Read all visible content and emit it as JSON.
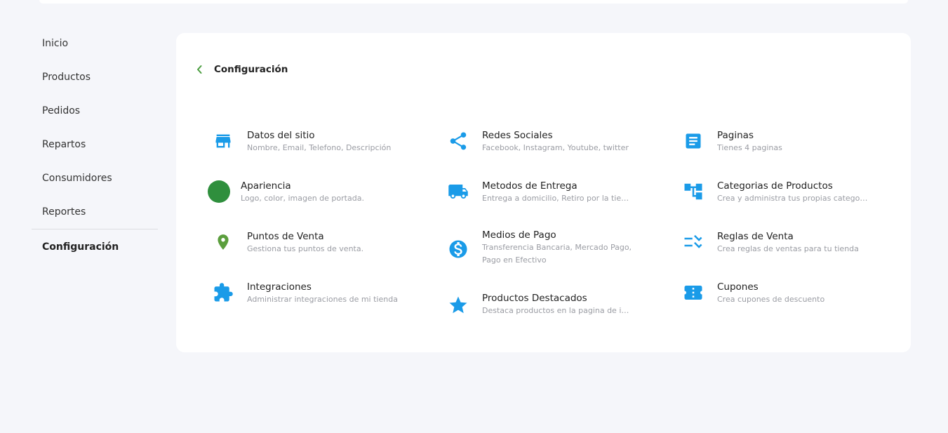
{
  "sidebar": {
    "items": [
      {
        "label": "Inicio"
      },
      {
        "label": "Productos"
      },
      {
        "label": "Pedidos"
      },
      {
        "label": "Repartos"
      },
      {
        "label": "Consumidores"
      },
      {
        "label": "Reportes"
      },
      {
        "label": "Configuración"
      }
    ]
  },
  "header": {
    "title": "Configuración"
  },
  "colors": {
    "accent_blue": "#1a9be8",
    "green": "#2f8f3d",
    "pin_green": "#5b9e3d",
    "back_arrow": "#4a9d3e"
  },
  "items": {
    "datos": {
      "title": "Datos del sitio",
      "subtitle": "Nombre, Email, Telefono, Descripción",
      "icon": "store-icon"
    },
    "redes": {
      "title": "Redes Sociales",
      "subtitle": "Facebook, Instagram, Youtube, twitter",
      "icon": "share-icon"
    },
    "paginas": {
      "title": "Paginas",
      "subtitle": "Tienes 4 paginas",
      "icon": "document-icon"
    },
    "apariencia": {
      "title": "Apariencia",
      "subtitle": "Logo, color, imagen de portada.",
      "icon": "color-circle-icon"
    },
    "entrega": {
      "title": "Metodos de Entrega",
      "subtitle": "Entrega a domicilio, Retiro por la tienda",
      "icon": "truck-icon"
    },
    "categorias": {
      "title": "Categorias de Productos",
      "subtitle": "Crea y administra tus propias categorias",
      "icon": "category-tree-icon"
    },
    "puntos": {
      "title": "Puntos de Venta",
      "subtitle": "Gestiona tus puntos de venta.",
      "icon": "location-pin-icon"
    },
    "pago": {
      "title": "Medios de Pago",
      "subtitle": "Transferencia Bancaria, Mercado Pago,",
      "subtitle2": "Pago en Efectivo",
      "icon": "dollar-circle-icon"
    },
    "reglas": {
      "title": "Reglas de Venta",
      "subtitle": "Crea reglas de ventas para tu tienda",
      "icon": "rules-check-icon"
    },
    "integraciones": {
      "title": "Integraciones",
      "subtitle": "Administrar integraciones de mi tienda",
      "icon": "puzzle-icon"
    },
    "destacados": {
      "title": "Productos Destacados",
      "subtitle": "Destaca productos en la pagina de inicio",
      "icon": "star-icon"
    },
    "cupones": {
      "title": "Cupones",
      "subtitle": "Crea cupones de descuento",
      "icon": "coupon-icon"
    }
  }
}
